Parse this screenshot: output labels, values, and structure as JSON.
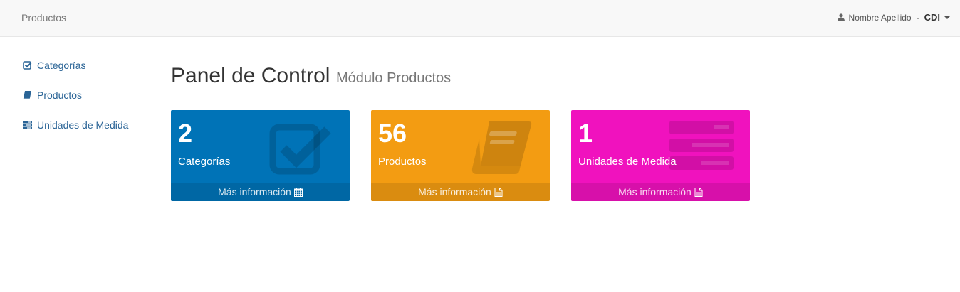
{
  "navbar": {
    "brand": "Productos",
    "user_name": "Nombre Apellido",
    "user_sep": "-",
    "user_org": "CDI"
  },
  "sidebar": {
    "items": [
      {
        "label": "Categorías",
        "icon": "check-square-icon"
      },
      {
        "label": "Productos",
        "icon": "book-icon"
      },
      {
        "label": "Unidades de Medida",
        "icon": "list-icon"
      }
    ]
  },
  "header": {
    "title": "Panel de Control",
    "subtitle": "Módulo Productos"
  },
  "cards": [
    {
      "count": "2",
      "label": "Categorías",
      "footer": "Más información",
      "color": "#0073b7",
      "icon": "check-square-icon",
      "footer_icon": "calendar-icon"
    },
    {
      "count": "56",
      "label": "Productos",
      "footer": "Más información",
      "color": "#f39c12",
      "icon": "book-icon",
      "footer_icon": "file-icon"
    },
    {
      "count": "1",
      "label": "Unidades de Medida",
      "footer": "Más información",
      "color": "#f012be",
      "icon": "list-icon",
      "footer_icon": "file-icon"
    }
  ]
}
